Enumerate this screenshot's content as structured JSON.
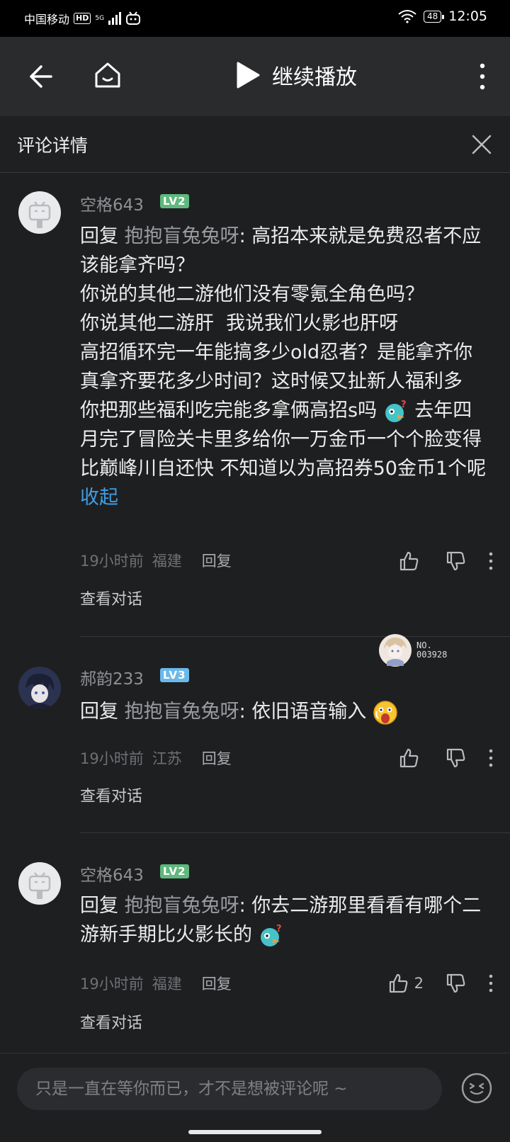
{
  "status_bar": {
    "carrier": "中国移动",
    "hd": "HD",
    "network": "5G",
    "battery": "48",
    "time": "12:05"
  },
  "top_bar": {
    "resume_label": "继续播放"
  },
  "section": {
    "title": "评论详情"
  },
  "comments": [
    {
      "username": "空格643",
      "level": "LV2",
      "reply_prefix": "回复",
      "reply_to": "抱抱盲兔兔呀",
      "text_before_emoji": ": 高招本来就是免费忍者不应该能拿齐吗？\n你说的其他二游他们没有零氪全角色吗？\n你说其他二游肝  我说我们火影也肝呀\n高招循环完一年能搞多少old忍者？是能拿齐你真拿齐要花多少时间？这时候又扯新人福利多  你把那些福利吃完能多拿俩高招s吗",
      "text_after_emoji": "去年四月完了冒险关卡里多给你一万金币一个个脸变得比巅峰川自还快   不知道以为高招券50金币1个呢",
      "collapse_label": "收起",
      "time": "19小时前",
      "location": "福建",
      "reply_label": "回复",
      "likes": "",
      "view_conversation": "查看对话"
    },
    {
      "username": "郝韵233",
      "level": "LV3",
      "reply_prefix": "回复",
      "reply_to": "抱抱盲兔兔呀",
      "text": ": 依旧语音输入",
      "badge_number": "NO.\n003928",
      "time": "19小时前",
      "location": "江苏",
      "reply_label": "回复",
      "likes": "",
      "view_conversation": "查看对话"
    },
    {
      "username": "空格643",
      "level": "LV2",
      "reply_prefix": "回复",
      "reply_to": "抱抱盲兔兔呀",
      "text": ": 你去二游那里看看有哪个二游新手期比火影长的",
      "time": "19小时前",
      "location": "福建",
      "reply_label": "回复",
      "likes": "2",
      "view_conversation": "查看对话"
    }
  ],
  "input": {
    "placeholder": "只是一直在等你而已，才不是想被评论呢 ~"
  },
  "colors": {
    "background": "#1e1f21",
    "link": "#3f9ee4",
    "lv2": "#5fb87d",
    "lv3": "#6cb8ea"
  }
}
